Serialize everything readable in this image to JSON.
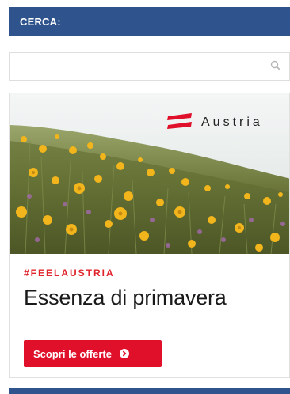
{
  "search": {
    "header_label": "CERCA:",
    "value": "",
    "icon": "search-icon"
  },
  "ad": {
    "brand_name": "Austria",
    "brand_icon": "austria-flag-logo",
    "hashtag": "#FEELAUSTRIA",
    "headline": "Essenza di primavera",
    "cta_label": "Scopri le offerte",
    "cta_icon": "arrow-right-circle-icon",
    "accent_color": "#e0102a"
  },
  "colors": {
    "header_bar": "#2f548d",
    "hashtag": "#e0242b"
  }
}
